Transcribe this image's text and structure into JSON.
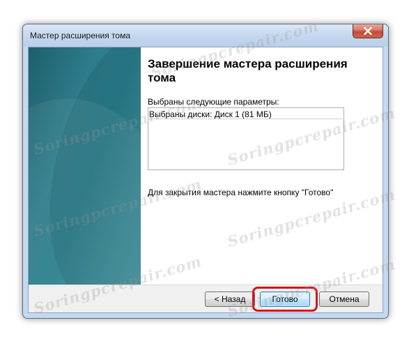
{
  "window": {
    "title": "Мастер расширения тома"
  },
  "wizard": {
    "heading": "Завершение мастера расширения тома",
    "params_label": "Выбраны следующие параметры:",
    "params_text": "Выбраны диски: Диск 1 (81 МБ)",
    "close_hint": "Для закрытия мастера нажмите кнопку \"Готово\""
  },
  "buttons": {
    "back": "< Назад",
    "finish": "Готово",
    "cancel": "Отмена"
  },
  "watermark": {
    "text": "Soringpcrepair.com"
  },
  "colors": {
    "highlight": "#d4151c",
    "banner": "#2f7d8b",
    "close_button": "#c24a34"
  },
  "icons": {
    "close": "close-icon"
  }
}
